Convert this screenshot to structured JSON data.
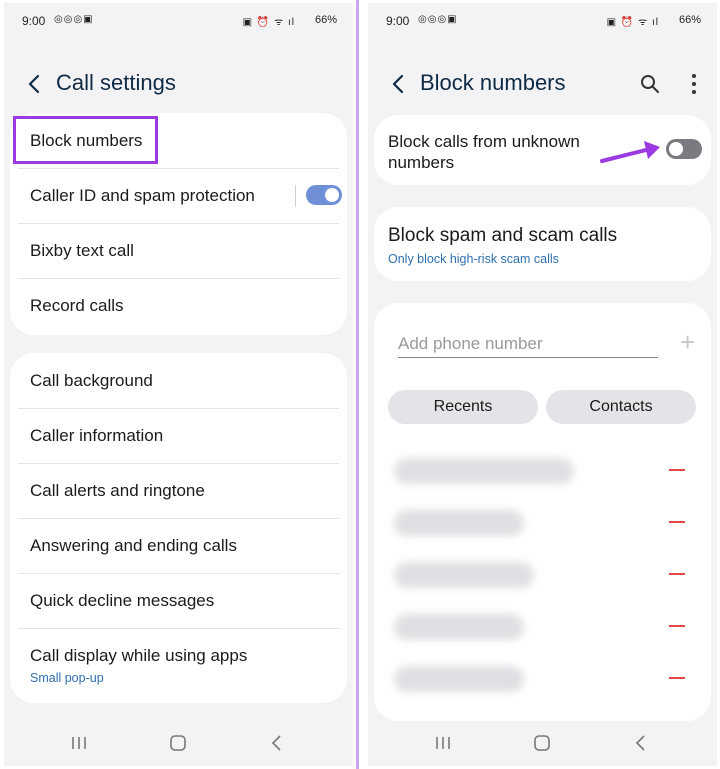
{
  "left": {
    "status": {
      "time": "9:00",
      "left_icons": "◎◎◎▣",
      "sys_icons": "▣ ⏰ ᯤ ıl",
      "battery": "66%"
    },
    "header": {
      "title": "Call settings"
    },
    "card1": [
      {
        "label": "Block numbers"
      },
      {
        "label": "Caller ID and spam protection",
        "toggle": "on"
      },
      {
        "label": "Bixby text call"
      },
      {
        "label": "Record calls"
      }
    ],
    "card2": [
      {
        "label": "Call background"
      },
      {
        "label": "Caller information"
      },
      {
        "label": "Call alerts and ringtone"
      },
      {
        "label": "Answering and ending calls"
      },
      {
        "label": "Quick decline messages"
      },
      {
        "label": "Call display while using apps",
        "sub": "Small pop-up"
      }
    ]
  },
  "right": {
    "status": {
      "time": "9:00",
      "left_icons": "◎◎◎▣",
      "sys_icons": "▣ ⏰ ᯤ ıl",
      "battery": "66%"
    },
    "header": {
      "title": "Block numbers"
    },
    "unknown": {
      "label": "Block calls from unknown numbers",
      "toggle": "off"
    },
    "spam": {
      "label": "Block spam and scam calls",
      "sub": "Only block high-risk scam calls"
    },
    "add": {
      "placeholder": "Add phone number",
      "recents": "Recents",
      "contacts": "Contacts"
    }
  },
  "colors": {
    "accent": "#9b39e3",
    "toggle_on": "#6f8fd6",
    "link": "#2f6fb0",
    "remove": "#e04747"
  }
}
